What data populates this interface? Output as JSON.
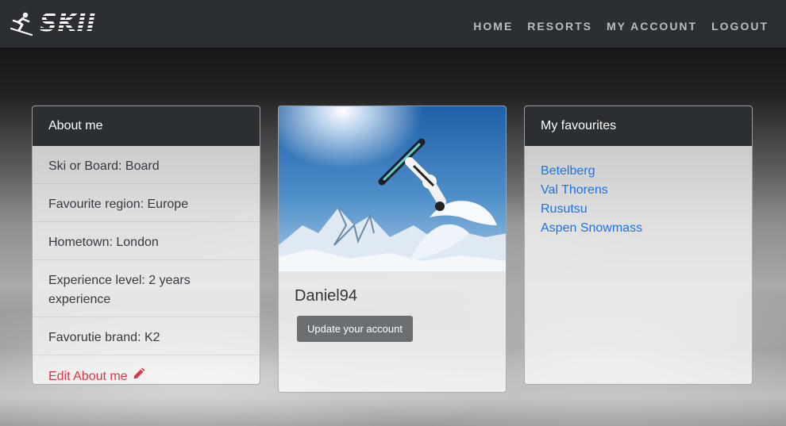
{
  "brand": {
    "logo_text": "SKII",
    "icon": "skier-icon"
  },
  "nav": {
    "items": [
      {
        "label": "HOME"
      },
      {
        "label": "RESORTS"
      },
      {
        "label": "MY ACCOUNT"
      },
      {
        "label": "LOGOUT"
      }
    ]
  },
  "about": {
    "title": "About me",
    "items": [
      "Ski or Board: Board",
      "Favourite region: Europe",
      "Hometown: London",
      "Experience level: 2 years experience",
      "Favorutie brand: K2"
    ],
    "edit_label": "Edit About me",
    "edit_icon": "pencil-icon"
  },
  "profile": {
    "username": "Daniel94",
    "update_button": "Update your account",
    "image": "snowboarder-photo"
  },
  "favourites": {
    "title": "My favourites",
    "items": [
      "Betelberg",
      "Val Thorens",
      "Rusutsu",
      "Aspen Snowmass"
    ]
  },
  "colors": {
    "navbar": "#2b2f33",
    "link_blue": "#1a73e8",
    "edit_red": "#dc3545",
    "button_grey": "#6c6f72"
  }
}
